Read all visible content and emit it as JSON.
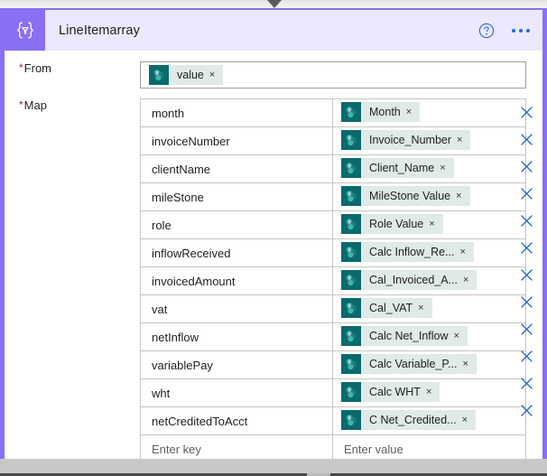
{
  "window": {
    "collapse_chevron": "chevron-down"
  },
  "card": {
    "title": "LineItemarray",
    "node_icon": "braces-filter-icon",
    "accent_color": "#8a6ff5",
    "header_bg": "#ece8fd",
    "help_icon": "help-circle-icon",
    "more_icon": "ellipsis-icon"
  },
  "from": {
    "label": "From",
    "required_marker": "*",
    "token": {
      "text": "value",
      "icon": "sharepoint-icon",
      "remove": "×"
    }
  },
  "map": {
    "label": "Map",
    "required_marker": "*",
    "key_placeholder": "Enter key",
    "value_placeholder": "Enter value",
    "row_delete_icon": "close-icon",
    "row_text_mode_icon": "switch-to-text-icon",
    "rows": [
      {
        "key": "month",
        "value": "Month"
      },
      {
        "key": "invoiceNumber",
        "value": "Invoice_Number"
      },
      {
        "key": "clientName",
        "value": "Client_Name"
      },
      {
        "key": "mileStone",
        "value": "MileStone Value"
      },
      {
        "key": "role",
        "value": "Role Value"
      },
      {
        "key": "inflowReceived",
        "value": "Calc Inflow_Re..."
      },
      {
        "key": "invoicedAmount",
        "value": "Cal_Invoiced_A..."
      },
      {
        "key": "vat",
        "value": "Cal_VAT"
      },
      {
        "key": "netInflow",
        "value": "Calc Net_Inflow"
      },
      {
        "key": "variablePay",
        "value": "Calc Variable_P..."
      },
      {
        "key": "wht",
        "value": "Calc WHT"
      },
      {
        "key": "netCreditedToAcct",
        "value": "C Net_Credited..."
      }
    ]
  },
  "colors": {
    "token_bg": "#dfeae9",
    "token_icon_bg": "#0b6a6a",
    "action_blue": "#2566d8",
    "required_red": "#a4262c"
  }
}
